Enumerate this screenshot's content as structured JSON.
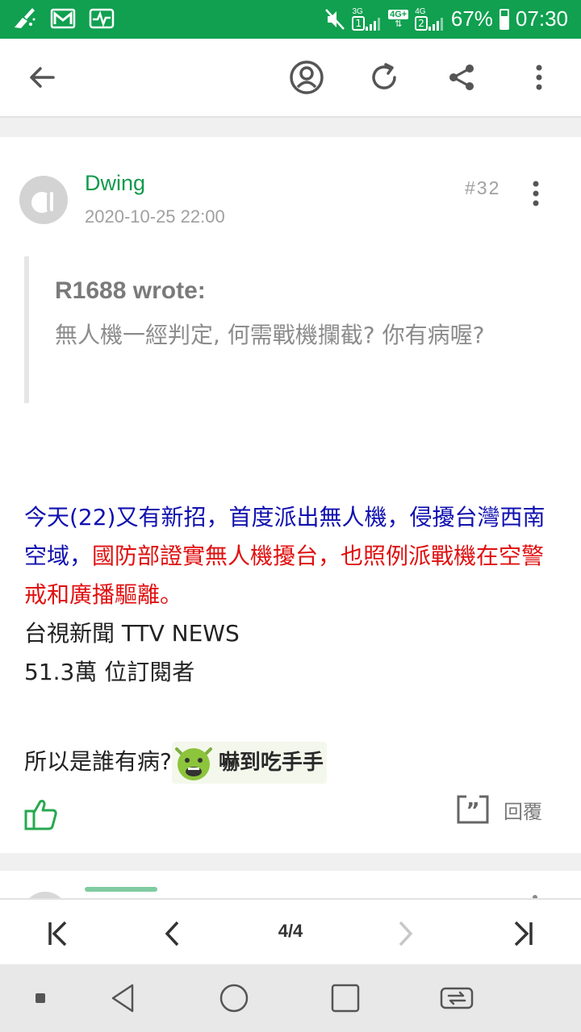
{
  "status_bar": {
    "battery": "67%",
    "time": "07:30",
    "net1": "3G",
    "net2": "4G+",
    "net3": "4G",
    "sim1": "1",
    "sim2": "2",
    "icons": [
      "cleaner-icon",
      "gmail-icon",
      "activity-icon",
      "mute-icon",
      "signal-icon",
      "battery-icon"
    ]
  },
  "toolbar": {
    "icons": [
      "back-arrow-icon",
      "account-icon",
      "refresh-icon",
      "share-icon",
      "more-icon"
    ]
  },
  "post": {
    "username": "Dwing",
    "date": "2020-10-25 22:00",
    "number": "#32",
    "quote": {
      "author": "R1688 wrote:",
      "text": "無人機一經判定, 何需戰機攔截? 你有病喔?"
    },
    "body": {
      "blue_text": "今天(22)又有新招，首度派出無人機，侵擾台灣西南空域，",
      "red_text": "國防部證實無人機擾台，也照例派戰機在空警戒和廣播驅離。",
      "source": "台視新聞 TTV NEWS",
      "subscribers": "51.3萬 位訂閱者",
      "question": "所以是誰有病?",
      "sticker_text": "嚇到吃手手"
    },
    "reply_label": "回覆"
  },
  "pager": {
    "indicator": "4/4"
  },
  "colors": {
    "brand_green": "#10a050",
    "username_green": "#109a4c",
    "link_blue": "#1010b0",
    "highlight_red": "#e01010"
  }
}
